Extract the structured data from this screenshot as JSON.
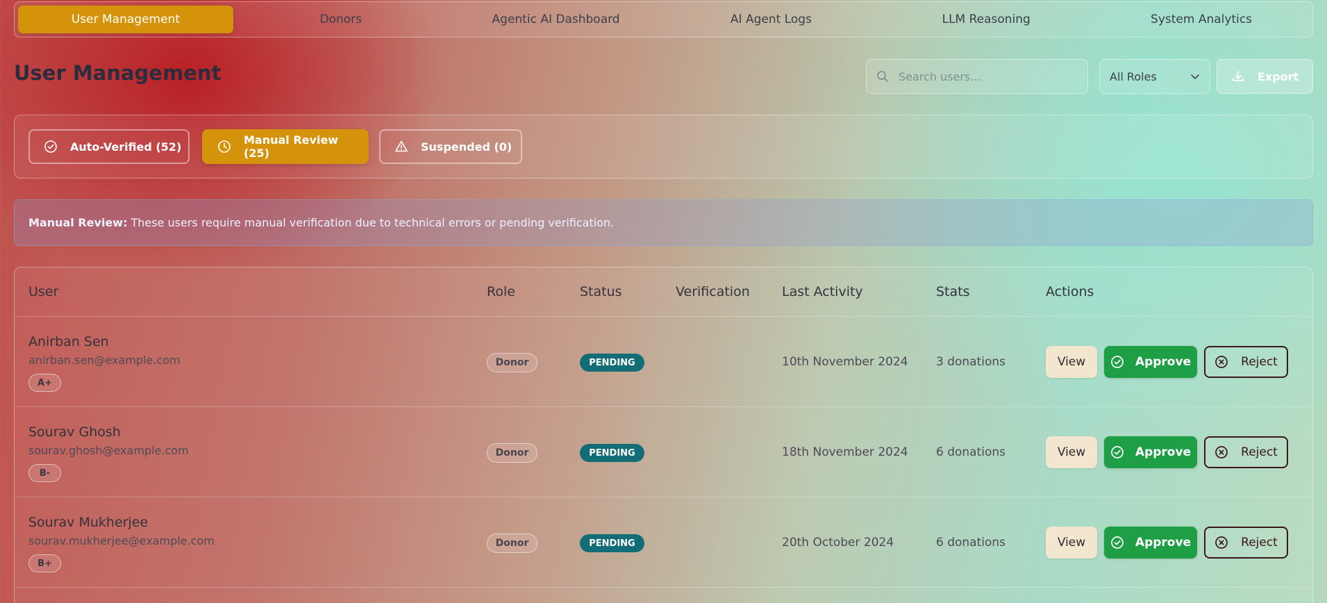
{
  "nav": {
    "tabs": [
      {
        "label": "User Management",
        "active": true
      },
      {
        "label": "Donors",
        "active": false
      },
      {
        "label": "Agentic AI Dashboard",
        "active": false
      },
      {
        "label": "AI Agent Logs",
        "active": false
      },
      {
        "label": "LLM Reasoning",
        "active": false
      },
      {
        "label": "System Analytics",
        "active": false
      }
    ]
  },
  "header": {
    "title": "User Management",
    "search_placeholder": "Search users...",
    "role_filter": "All Roles",
    "export_label": "Export"
  },
  "filters": [
    {
      "label": "Auto-Verified (52)",
      "icon": "check-circle-icon",
      "active": false
    },
    {
      "label": "Manual Review (25)",
      "icon": "clock-icon",
      "active": true
    },
    {
      "label": "Suspended (0)",
      "icon": "warning-icon",
      "active": false
    }
  ],
  "banner": {
    "title": "Manual Review:",
    "text": "These users require manual verification due to technical errors or pending verification."
  },
  "table": {
    "columns": [
      "User",
      "Role",
      "Status",
      "Verification",
      "Last Activity",
      "Stats",
      "Actions"
    ],
    "rows": [
      {
        "name": "Anirban Sen",
        "email": "anirban.sen@example.com",
        "blood": "A+",
        "role": "Donor",
        "status": "PENDING",
        "verification": "",
        "last_activity": "10th November 2024",
        "stats": "3 donations"
      },
      {
        "name": "Sourav Ghosh",
        "email": "sourav.ghosh@example.com",
        "blood": "B-",
        "role": "Donor",
        "status": "PENDING",
        "verification": "",
        "last_activity": "18th November 2024",
        "stats": "6 donations"
      },
      {
        "name": "Sourav Mukherjee",
        "email": "sourav.mukherjee@example.com",
        "blood": "B+",
        "role": "Donor",
        "status": "PENDING",
        "verification": "",
        "last_activity": "20th October 2024",
        "stats": "6 donations"
      }
    ],
    "actions": {
      "view": "View",
      "approve": "Approve",
      "reject": "Reject"
    }
  },
  "colors": {
    "accent": "#d4930a",
    "pending": "#136d76",
    "approve": "#1e9e45",
    "reject_border": "#3b1517"
  }
}
